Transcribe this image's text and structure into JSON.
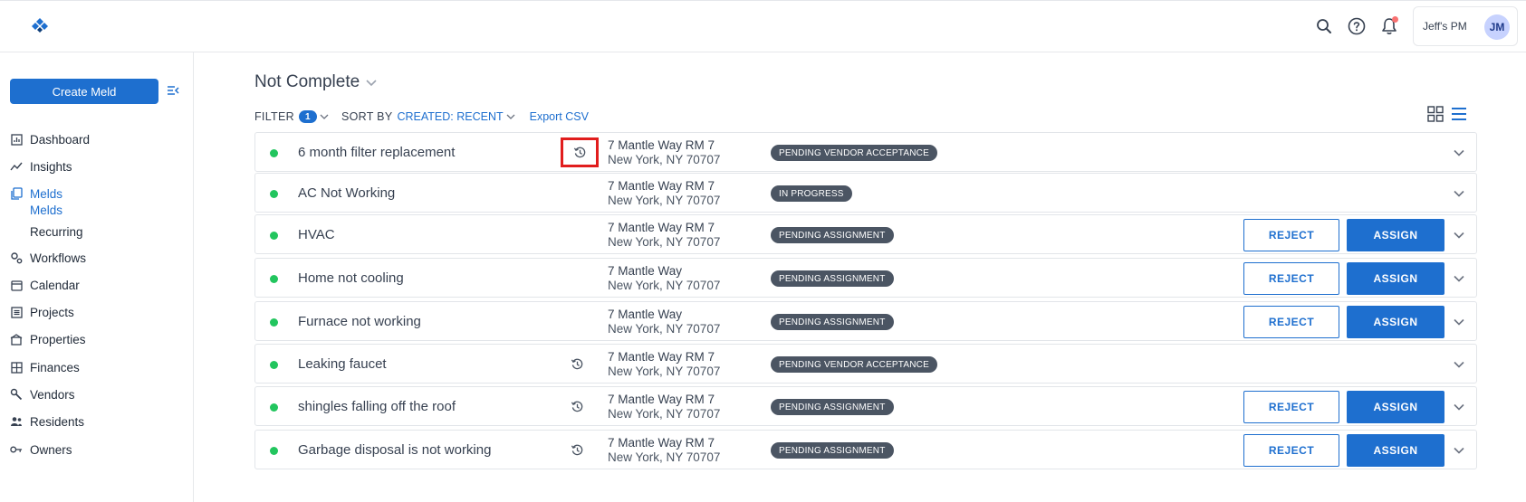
{
  "header": {
    "account_name": "Jeff's PM",
    "avatar_initials": "JM",
    "icons": [
      "search-icon",
      "help-icon",
      "bell-icon"
    ]
  },
  "sidebar": {
    "create_label": "Create Meld",
    "items": [
      {
        "label": "Dashboard",
        "icon": "dashboard-icon"
      },
      {
        "label": "Insights",
        "icon": "insights-icon"
      },
      {
        "label": "Melds",
        "icon": "melds-icon",
        "active": true
      },
      {
        "label": "Workflows",
        "icon": "workflows-icon"
      },
      {
        "label": "Calendar",
        "icon": "calendar-icon"
      },
      {
        "label": "Projects",
        "icon": "projects-icon"
      },
      {
        "label": "Properties",
        "icon": "properties-icon"
      },
      {
        "label": "Finances",
        "icon": "finances-icon"
      },
      {
        "label": "Vendors",
        "icon": "vendors-icon"
      },
      {
        "label": "Residents",
        "icon": "residents-icon"
      },
      {
        "label": "Owners",
        "icon": "owners-icon"
      }
    ],
    "sub_items": [
      {
        "label": "Melds",
        "active": true
      },
      {
        "label": "Recurring"
      }
    ]
  },
  "main": {
    "title": "Not Complete",
    "filter_label": "FILTER",
    "filter_count": "1",
    "sort_label": "SORT BY",
    "sort_value": "CREATED: RECENT",
    "export_label": "Export CSV"
  },
  "colors": {
    "accent": "#1e6fcf",
    "status_dot": "#22c55e",
    "status_pill": "#4b5563",
    "highlight": "#e11d1d"
  },
  "melds": [
    {
      "title": "6 month filter replacement",
      "recurring": true,
      "highlight": true,
      "addr1": "7 Mantle Way RM 7",
      "addr2": "New York, NY 70707",
      "status": "PENDING VENDOR ACCEPTANCE",
      "actions": false
    },
    {
      "title": "AC Not Working",
      "recurring": false,
      "addr1": "7 Mantle Way RM 7",
      "addr2": "New York, NY 70707",
      "status": "IN PROGRESS",
      "actions": false
    },
    {
      "title": "HVAC",
      "recurring": false,
      "addr1": "7 Mantle Way RM 7",
      "addr2": "New York, NY 70707",
      "status": "PENDING ASSIGNMENT",
      "actions": true
    },
    {
      "title": "Home not cooling",
      "recurring": false,
      "addr1": "7 Mantle Way",
      "addr2": "New York, NY 70707",
      "status": "PENDING ASSIGNMENT",
      "actions": true
    },
    {
      "title": "Furnace not working",
      "recurring": false,
      "addr1": "7 Mantle Way",
      "addr2": "New York, NY 70707",
      "status": "PENDING ASSIGNMENT",
      "actions": true
    },
    {
      "title": "Leaking faucet",
      "recurring": true,
      "addr1": "7 Mantle Way RM 7",
      "addr2": "New York, NY 70707",
      "status": "PENDING VENDOR ACCEPTANCE",
      "actions": false
    },
    {
      "title": "shingles falling off the roof",
      "recurring": true,
      "addr1": "7 Mantle Way RM 7",
      "addr2": "New York, NY 70707",
      "status": "PENDING ASSIGNMENT",
      "actions": true
    },
    {
      "title": "Garbage disposal is not working",
      "recurring": true,
      "addr1": "7 Mantle Way RM 7",
      "addr2": "New York, NY 70707",
      "status": "PENDING ASSIGNMENT",
      "actions": true
    }
  ],
  "row_actions": {
    "reject_label": "REJECT",
    "assign_label": "ASSIGN"
  }
}
